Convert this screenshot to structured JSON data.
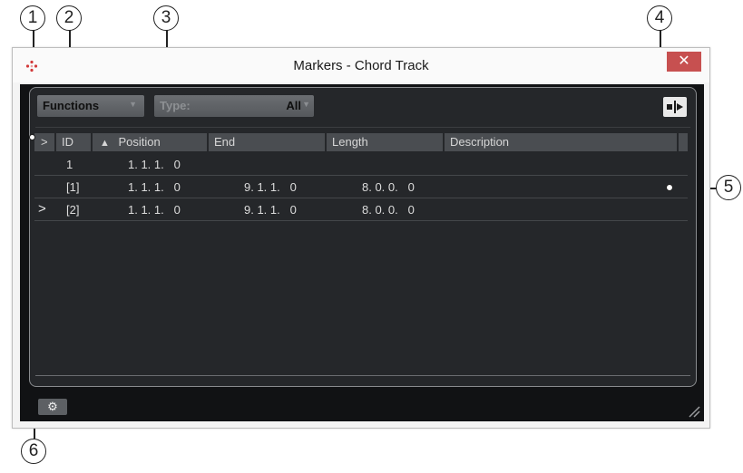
{
  "callouts": [
    "1",
    "2",
    "3",
    "4",
    "5",
    "6"
  ],
  "window": {
    "title": "Markers - Chord Track",
    "close_label": "✕"
  },
  "toolbar": {
    "functions_label": "Functions",
    "type_label": "Type:",
    "type_value": "All"
  },
  "table": {
    "headers": {
      "active": ">",
      "id": "ID",
      "position": "Position",
      "end": "End",
      "length": "Length",
      "description": "Description"
    },
    "rows": [
      {
        "active": "",
        "id": "1",
        "position": "1. 1. 1.   0",
        "end": "",
        "length": "",
        "description": ""
      },
      {
        "active": "",
        "id": "[1]",
        "position": "1. 1. 1.   0",
        "end": "9. 1. 1.   0",
        "length": "8. 0. 0.   0",
        "description": ""
      },
      {
        "active": ">",
        "id": "[2]",
        "position": "1. 1. 1.   0",
        "end": "9. 1. 1.   0",
        "length": "8. 0. 0.   0",
        "description": ""
      }
    ]
  },
  "icons": {
    "app": "cubase-logo-icon",
    "locator": "locate-icon",
    "gear": "gear-icon",
    "sort": "sort-ascending-icon",
    "resize": "resize-grip-icon"
  },
  "colors": {
    "close_button": "#c75050",
    "panel_bg": "#25272a",
    "header_bg": "#4a4d51"
  }
}
